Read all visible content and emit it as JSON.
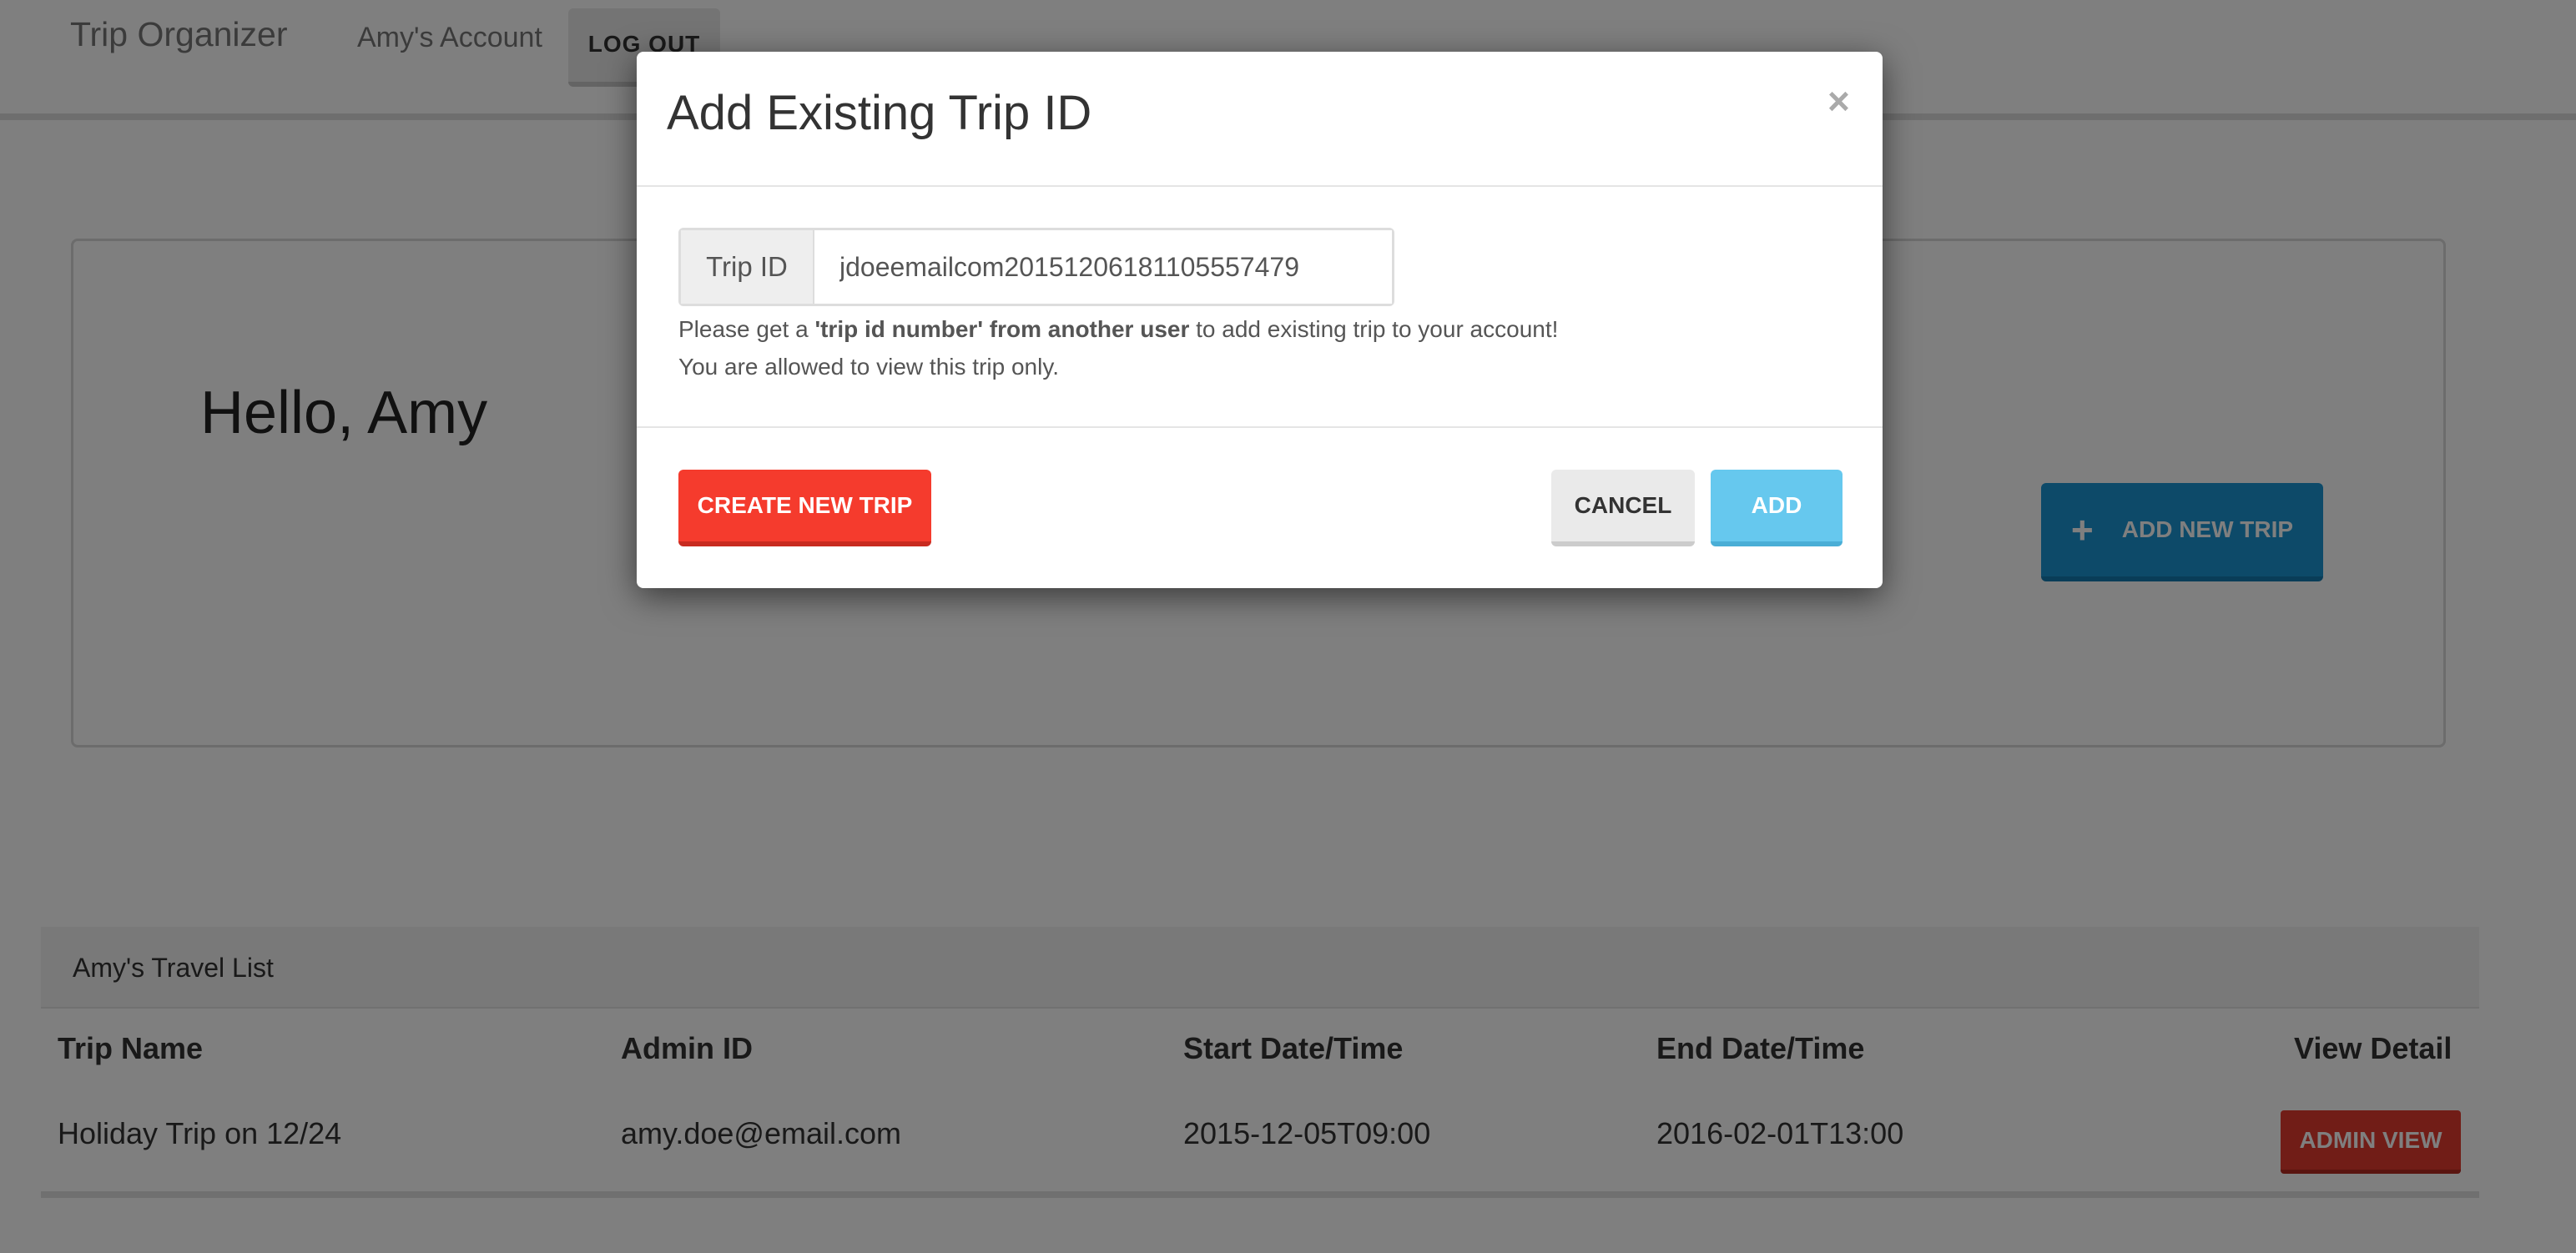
{
  "navbar": {
    "brand": "Trip Organizer",
    "account_link": "Amy's Account",
    "logout_label": "LOG OUT"
  },
  "hero": {
    "greeting": "Hello, Amy",
    "add_new_trip_icon": "plus-icon",
    "add_new_trip_label": "ADD NEW TRIP"
  },
  "travel_list": {
    "title": "Amy's Travel List",
    "columns": [
      "Trip Name",
      "Admin ID",
      "Start Date/Time",
      "End Date/Time",
      "View Detail"
    ],
    "rows": [
      {
        "trip_name": "Holiday Trip on 12/24",
        "admin_id": "amy.doe@email.com",
        "start": "2015-12-05T09:00",
        "end": "2016-02-01T13:00",
        "action_label": "ADMIN VIEW"
      }
    ]
  },
  "modal": {
    "title": "Add Existing Trip ID",
    "close_glyph": "×",
    "field_label": "Trip ID",
    "field_value": "jdoeemailcom20151206181105557479",
    "help_prefix": "Please get a ",
    "help_bold": "'trip id number' from another user",
    "help_suffix": " to add existing trip to your account!",
    "help_line2": "You are allowed to view this trip only.",
    "create_label": "CREATE NEW TRIP",
    "cancel_label": "CANCEL",
    "add_label": "ADD"
  },
  "colors": {
    "primary": "#1b95d3",
    "danger": "#f53b2d",
    "info": "#66c8ee",
    "overlay": "rgba(0,0,0,0.5)"
  }
}
